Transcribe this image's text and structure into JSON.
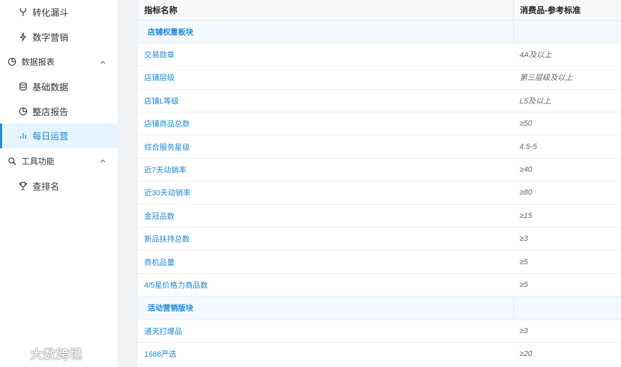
{
  "sidebar": {
    "items": [
      {
        "kind": "sub",
        "label": "转化漏斗",
        "icon": "funnel-icon",
        "active": false
      },
      {
        "kind": "sub",
        "label": "数字营销",
        "icon": "lightning-icon",
        "active": false
      },
      {
        "kind": "group",
        "label": "数据报表",
        "icon": "pie-chart-icon",
        "expanded": true
      },
      {
        "kind": "sub",
        "label": "基础数据",
        "icon": "database-icon",
        "active": false
      },
      {
        "kind": "sub",
        "label": "整店报告",
        "icon": "pie-chart-icon",
        "active": false
      },
      {
        "kind": "sub",
        "label": "每日运营",
        "icon": "bar-chart-icon",
        "active": true
      },
      {
        "kind": "group",
        "label": "工具功能",
        "icon": "search-icon",
        "expanded": true
      },
      {
        "kind": "sub",
        "label": "查排名",
        "icon": "trophy-icon",
        "active": false
      }
    ]
  },
  "watermark": {
    "text": "大数跨境"
  },
  "table": {
    "headers": {
      "name": "指标名称",
      "value": "消费品-参考标准"
    },
    "rows": [
      {
        "type": "section",
        "name": "店铺权重板块",
        "value": ""
      },
      {
        "type": "row",
        "name": "交易勋章",
        "value": "4A及以上"
      },
      {
        "type": "row",
        "name": "店铺层级",
        "value": "第三层级及以上"
      },
      {
        "type": "row",
        "name": "店铺L等级",
        "value": "L5及以上"
      },
      {
        "type": "row",
        "name": "店铺商品总数",
        "value": "≥50"
      },
      {
        "type": "row",
        "name": "综合服务星级",
        "value": "4.5-5"
      },
      {
        "type": "row",
        "name": "近7天动销率",
        "value": "≥40"
      },
      {
        "type": "row",
        "name": "近30天动销率",
        "value": "≥80"
      },
      {
        "type": "row",
        "name": "金冠品数",
        "value": "≥15"
      },
      {
        "type": "row",
        "name": "新品扶持总数",
        "value": "≥3"
      },
      {
        "type": "row",
        "name": "商机品量",
        "value": "≥5"
      },
      {
        "type": "row",
        "name": "4/5星价格力商品数",
        "value": "≥5"
      },
      {
        "type": "section",
        "name": "活动营销版块",
        "value": ""
      },
      {
        "type": "row",
        "name": "通天打爆品",
        "value": "≥3"
      },
      {
        "type": "row",
        "name": "1688严选",
        "value": "≥20"
      }
    ]
  },
  "colors": {
    "accent": "#1e88d5",
    "active_bg": "#e6f4ff",
    "section_bg": "#f3f8fe"
  }
}
